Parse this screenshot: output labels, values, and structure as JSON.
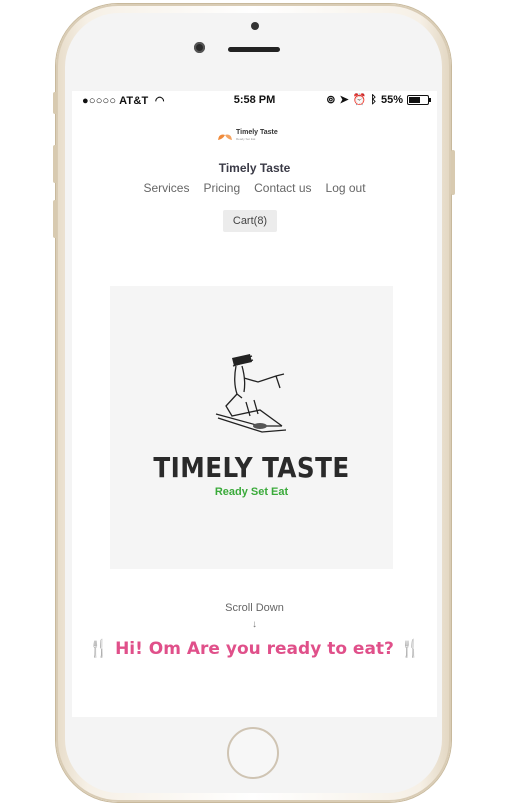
{
  "statusbar": {
    "carrier": "●○○○○ AT&T",
    "time": "5:58 PM",
    "battery": "55%",
    "battery_level": 0.55
  },
  "header": {
    "logo_text": "Timely Taste",
    "logo_tagline": "Ready Set Eat",
    "title": "Timely Taste"
  },
  "nav": {
    "items": [
      "Services",
      "Pricing",
      "Contact us",
      "Log out"
    ]
  },
  "cart": {
    "label": "Cart(8)"
  },
  "hero": {
    "title": "TIMELY TASTE",
    "subtitle": "Ready Set Eat"
  },
  "scroll": {
    "label": "Scroll Down",
    "arrow": "↓"
  },
  "greeting": {
    "text": "Hi! Om Are you ready to eat?",
    "icon": "fork-knife-icon"
  },
  "colors": {
    "brand_orange": "#f08a3a",
    "tagline_green": "#3aaa3a",
    "greeting_pink": "#e0508a"
  }
}
